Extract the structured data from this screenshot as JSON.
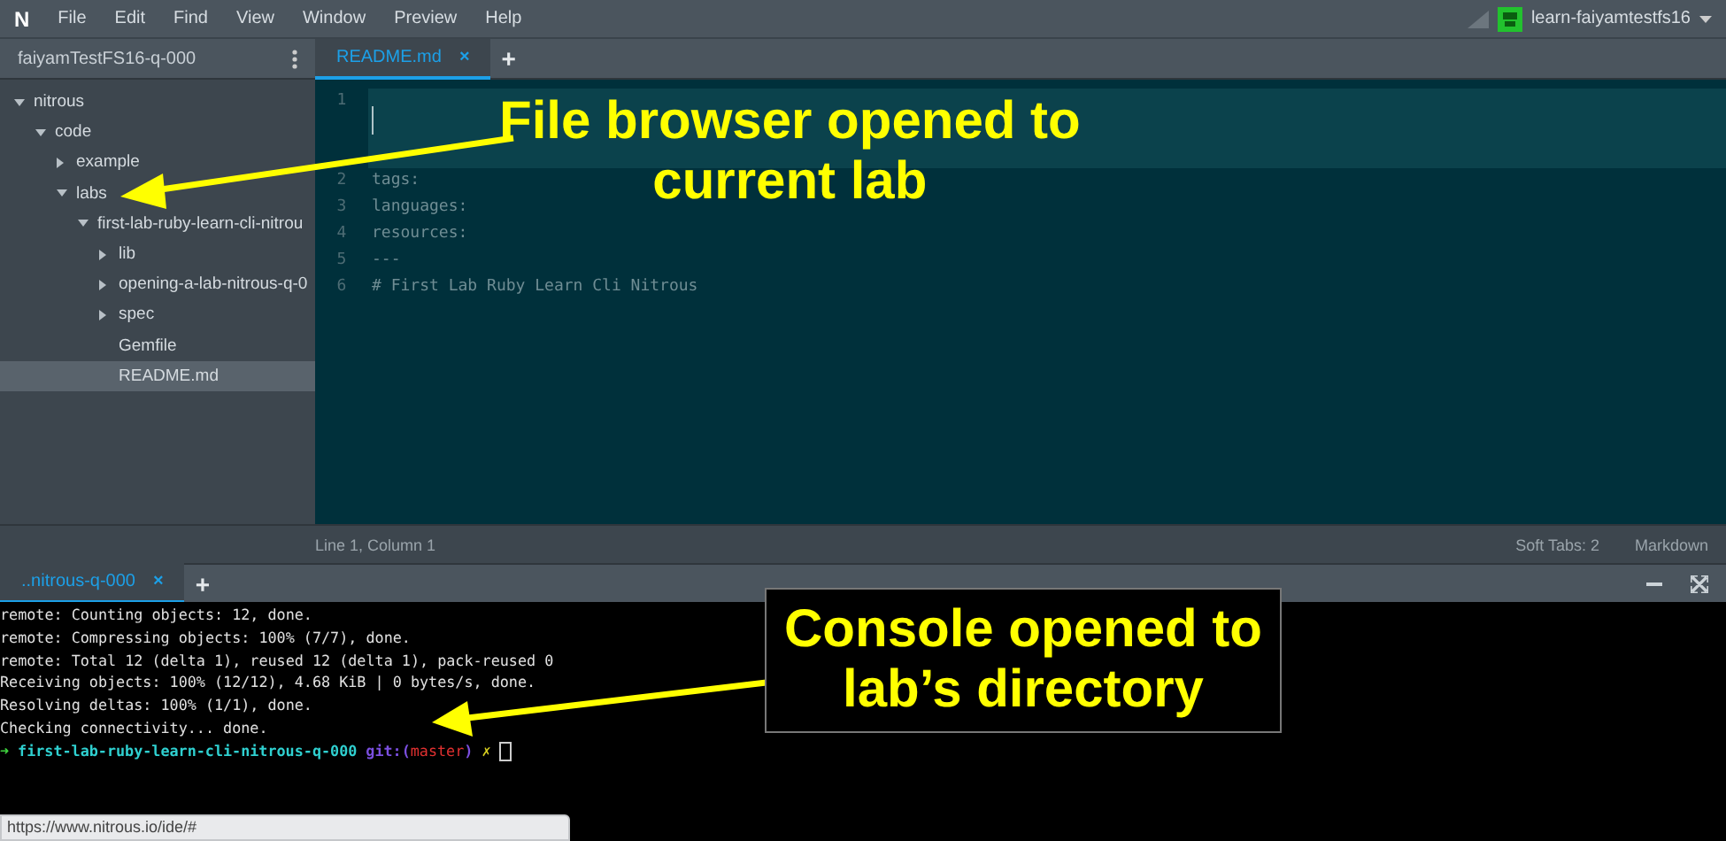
{
  "menu_bar": {
    "logo": "N",
    "items": [
      "File",
      "Edit",
      "Find",
      "View",
      "Window",
      "Preview",
      "Help"
    ],
    "account": "learn-faiyamtestfs16"
  },
  "sidebar": {
    "title": "faiyamTestFS16-q-000",
    "tree": [
      {
        "label": "nitrous",
        "folder": true,
        "expanded": true,
        "selected": false,
        "children": [
          {
            "label": "code",
            "folder": true,
            "expanded": true,
            "selected": false,
            "children": [
              {
                "label": "example",
                "folder": true,
                "expanded": false,
                "selected": false
              },
              {
                "label": "labs",
                "folder": true,
                "expanded": true,
                "selected": false,
                "children": [
                  {
                    "label": "first-lab-ruby-learn-cli-nitrou",
                    "folder": true,
                    "expanded": true,
                    "selected": false,
                    "children": [
                      {
                        "label": "lib",
                        "folder": true,
                        "expanded": false,
                        "selected": false
                      },
                      {
                        "label": "opening-a-lab-nitrous-q-0",
                        "folder": true,
                        "expanded": false,
                        "selected": false
                      },
                      {
                        "label": "spec",
                        "folder": true,
                        "expanded": false,
                        "selected": false
                      },
                      {
                        "label": "Gemfile",
                        "folder": false,
                        "selected": false
                      },
                      {
                        "label": "README.md",
                        "folder": false,
                        "selected": true
                      }
                    ]
                  }
                ]
              }
            ]
          }
        ]
      }
    ]
  },
  "editor": {
    "tabs": [
      {
        "label": "README.md",
        "close": "×",
        "selected": true
      }
    ],
    "add": "+",
    "lines": [
      {
        "number": "1",
        "active": true
      },
      {
        "number": "2",
        "text": "tags:",
        "active": false
      },
      {
        "number": "3",
        "text": "languages:",
        "active": false
      },
      {
        "number": "4",
        "text": "resources:",
        "active": false
      },
      {
        "number": "5",
        "text": "---",
        "active": false
      },
      {
        "number": "6",
        "text": "# First Lab Ruby Learn Cli Nitrous",
        "active": false
      }
    ],
    "status_bar": {
      "position": "Line 1, Column 1",
      "soft_tabs": "Soft Tabs: 2",
      "mode": "Markdown"
    }
  },
  "terminal": {
    "tabs": [
      {
        "label": "..nitrous-q-000",
        "close": "×",
        "selected": true
      }
    ],
    "add": "+",
    "lines": [
      {
        "kind": "output",
        "text": "remote: Counting objects: 12, done."
      },
      {
        "kind": "output",
        "text": "remote: Compressing objects: 100% (7/7), done."
      },
      {
        "kind": "output",
        "text": "remote: Total 12 (delta 1), reused 12 (delta 1), pack-reused 0"
      },
      {
        "kind": "output",
        "text": "Receiving objects: 100% (12/12), 4.68 KiB | 0 bytes/s, done."
      },
      {
        "kind": "output",
        "text": "Resolving deltas: 100% (1/1), done."
      },
      {
        "kind": "output",
        "text": "Checking connectivity... done."
      },
      {
        "kind": "prompt",
        "arrow": "➜",
        "directory": "first-lab-ruby-learn-cli-nitrous-q-000",
        "git": "git:(",
        "branch": "master",
        "git_end": ")",
        "dirty": "✗"
      }
    ]
  },
  "link_preview": "https://www.nitrous.io/ide/#",
  "annotations": [
    {
      "kind": "plain",
      "lines": [
        "File browser opened to",
        "current lab"
      ]
    },
    {
      "kind": "boxed",
      "lines": [
        "Console opened to",
        "lab’s directory"
      ]
    }
  ]
}
